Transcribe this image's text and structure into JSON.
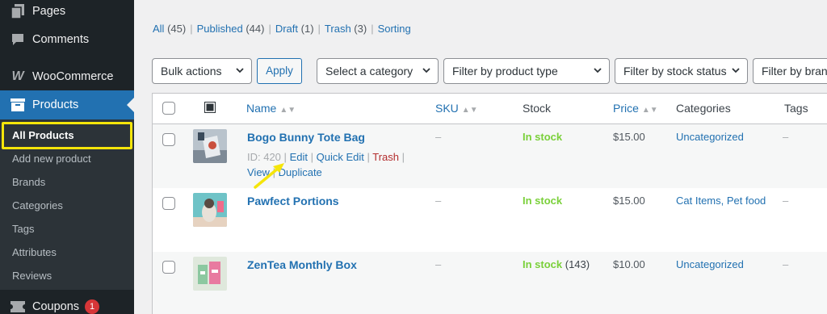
{
  "sidebar": {
    "items": [
      {
        "label": "Pages",
        "icon": "pages-icon"
      },
      {
        "label": "Comments",
        "icon": "comments-icon"
      },
      {
        "label": "WooCommerce",
        "icon": "woocommerce-icon"
      },
      {
        "label": "Products",
        "icon": "products-icon"
      },
      {
        "label": "Coupons",
        "icon": "coupons-icon",
        "badge": "1"
      }
    ],
    "submenu": [
      "All Products",
      "Add new product",
      "Brands",
      "Categories",
      "Tags",
      "Attributes",
      "Reviews"
    ]
  },
  "filters_links": {
    "all": "All",
    "all_count": "(45)",
    "published": "Published",
    "published_count": "(44)",
    "draft": "Draft",
    "draft_count": "(1)",
    "trash": "Trash",
    "trash_count": "(3)",
    "sorting": "Sorting",
    "separator": "|"
  },
  "toolbar": {
    "bulk_actions": "Bulk actions",
    "apply": "Apply",
    "category": "Select a category",
    "product_type": "Filter by product type",
    "stock_status": "Filter by stock status",
    "brand": "Filter by bran"
  },
  "table": {
    "headers": {
      "name": "Name",
      "sku": "SKU",
      "stock": "Stock",
      "price": "Price",
      "categories": "Categories",
      "tags": "Tags"
    },
    "rows": [
      {
        "name": "Bogo Bunny Tote Bag",
        "sku": "–",
        "stock": "In stock",
        "stock_count": "",
        "price": "$15.00",
        "categories": "Uncategorized",
        "tags": "–",
        "actions": {
          "id": "ID: 420",
          "edit": "Edit",
          "quick_edit": "Quick Edit",
          "trash": "Trash",
          "view": "View",
          "duplicate": "Duplicate",
          "sep": "|"
        }
      },
      {
        "name": "Pawfect Portions",
        "sku": "–",
        "stock": "In stock",
        "stock_count": "",
        "price": "$15.00",
        "categories": "Cat Items, Pet food",
        "tags": "–"
      },
      {
        "name": "ZenTea Monthly Box",
        "sku": "–",
        "stock": "In stock",
        "stock_count": "(143)",
        "price": "$10.00",
        "categories": "Uncategorized",
        "tags": "–"
      }
    ]
  },
  "colors": {
    "accent": "#2271b1",
    "sidebar": "#1d2327",
    "highlight": "#f5e50a",
    "in_stock": "#7ad03a",
    "trash": "#b32d2e"
  }
}
